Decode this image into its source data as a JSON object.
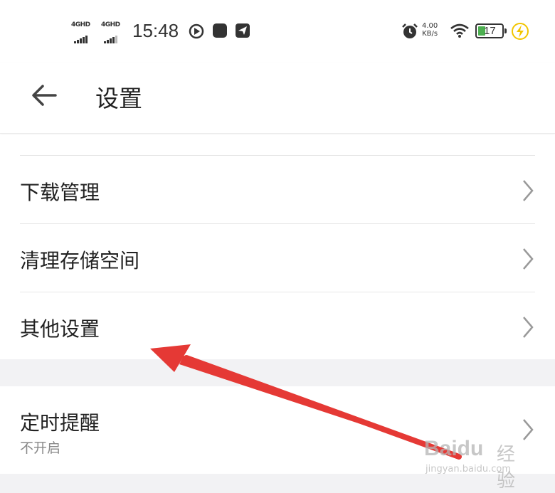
{
  "status_bar": {
    "network1": "4GHD",
    "network2": "4GHD",
    "time": "15:48",
    "speed_value": "4.00",
    "speed_unit": "KB/s",
    "battery_level": "17",
    "battery_color": "#4caf50",
    "icons": [
      "play-icon",
      "app-icon",
      "send-icon",
      "alarm-icon",
      "wifi-icon",
      "battery-icon",
      "charging-icon"
    ]
  },
  "header": {
    "back_icon": "arrow-left-icon",
    "title": "设置"
  },
  "settings": {
    "items": [
      {
        "label": "下载管理"
      },
      {
        "label": "清理存储空间"
      },
      {
        "label": "其他设置"
      }
    ],
    "timer": {
      "label": "定时提醒",
      "sublabel": "不开启"
    }
  },
  "annotation": {
    "arrow_color": "#e53935",
    "target": "其他设置"
  },
  "watermark": {
    "logo": "Baidu",
    "text": "经验",
    "url": "jingyan.baidu.com"
  }
}
